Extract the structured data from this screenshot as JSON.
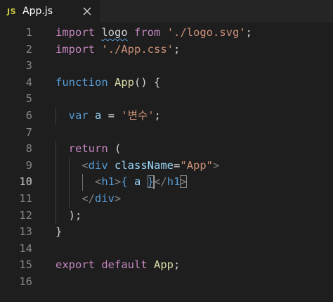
{
  "tab": {
    "icon_text": "JS",
    "filename": "App.js",
    "close_glyph": "×"
  },
  "colors": {
    "background": "#1e1e1e",
    "keyword_control": "#c586c0",
    "keyword": "#569cd6",
    "string": "#ce9178",
    "function": "#dcdcaa",
    "variable": "#9cdcfe",
    "js_icon": "#cbcb41"
  },
  "editor": {
    "active_line": 10,
    "lines": [
      {
        "n": "1",
        "tokens": [
          [
            "kw-ctrl",
            "import"
          ],
          [
            "plain",
            " "
          ],
          [
            "plain squig",
            "logo"
          ],
          [
            "plain",
            " "
          ],
          [
            "kw-ctrl",
            "from"
          ],
          [
            "plain",
            " "
          ],
          [
            "str",
            "'./logo.svg'"
          ],
          [
            "plain",
            ";"
          ]
        ]
      },
      {
        "n": "2",
        "tokens": [
          [
            "kw-ctrl",
            "import"
          ],
          [
            "plain",
            " "
          ],
          [
            "str",
            "'./App.css'"
          ],
          [
            "plain",
            ";"
          ]
        ]
      },
      {
        "n": "3",
        "tokens": []
      },
      {
        "n": "4",
        "tokens": [
          [
            "kw",
            "function"
          ],
          [
            "plain",
            " "
          ],
          [
            "fn",
            "App"
          ],
          [
            "plain",
            "() {"
          ]
        ]
      },
      {
        "n": "5",
        "tokens": []
      },
      {
        "n": "6",
        "tokens": [
          [
            "plain",
            "  "
          ],
          [
            "kw",
            "var"
          ],
          [
            "plain",
            " "
          ],
          [
            "var",
            "a"
          ],
          [
            "plain",
            " = "
          ],
          [
            "str",
            "'변수'"
          ],
          [
            "plain",
            ";"
          ]
        ]
      },
      {
        "n": "7",
        "tokens": []
      },
      {
        "n": "8",
        "tokens": [
          [
            "plain",
            "  "
          ],
          [
            "kw-ctrl",
            "return"
          ],
          [
            "plain",
            " ("
          ]
        ]
      },
      {
        "n": "9",
        "tokens": [
          [
            "plain",
            "    "
          ],
          [
            "tagc",
            "<"
          ],
          [
            "tag",
            "div"
          ],
          [
            "plain",
            " "
          ],
          [
            "attr",
            "className"
          ],
          [
            "plain",
            "="
          ],
          [
            "str",
            "\"App\""
          ],
          [
            "tagc",
            ">"
          ]
        ]
      },
      {
        "n": "10",
        "tokens": [
          [
            "plain",
            "      "
          ],
          [
            "tagc",
            "<"
          ],
          [
            "tag",
            "h1"
          ],
          [
            "tagc",
            ">"
          ],
          [
            "kw",
            "{"
          ],
          [
            "plain",
            " "
          ],
          [
            "var",
            "a"
          ],
          [
            "plain",
            " "
          ],
          [
            "kw bracket-box",
            "}"
          ],
          [
            "caret",
            ""
          ],
          [
            "tagc",
            "</"
          ],
          [
            "tag",
            "h1"
          ],
          [
            "tagc bracket-box",
            ">"
          ]
        ]
      },
      {
        "n": "11",
        "tokens": [
          [
            "plain",
            "    "
          ],
          [
            "tagc",
            "</"
          ],
          [
            "tag",
            "div"
          ],
          [
            "tagc",
            ">"
          ]
        ]
      },
      {
        "n": "12",
        "tokens": [
          [
            "plain",
            "  );"
          ]
        ]
      },
      {
        "n": "13",
        "tokens": [
          [
            "plain",
            "}"
          ]
        ]
      },
      {
        "n": "14",
        "tokens": []
      },
      {
        "n": "15",
        "tokens": [
          [
            "kw-ctrl",
            "export"
          ],
          [
            "plain",
            " "
          ],
          [
            "kw-ctrl",
            "default"
          ],
          [
            "plain",
            " "
          ],
          [
            "fn",
            "App"
          ],
          [
            "plain",
            ";"
          ]
        ]
      },
      {
        "n": "16",
        "tokens": []
      }
    ]
  }
}
